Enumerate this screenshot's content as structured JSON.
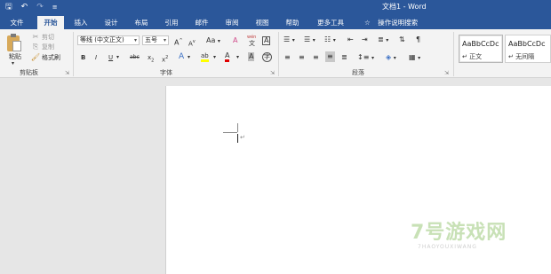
{
  "title_bar": {
    "document_title": "文档1 - Word",
    "save_icon": "save-icon",
    "undo_icon": "undo-icon",
    "redo_icon": "redo-icon",
    "customize_icon": "customize-qat-icon"
  },
  "tabs": [
    {
      "label": "文件",
      "active": false
    },
    {
      "label": "开始",
      "active": true
    },
    {
      "label": "插入",
      "active": false
    },
    {
      "label": "设计",
      "active": false
    },
    {
      "label": "布局",
      "active": false
    },
    {
      "label": "引用",
      "active": false
    },
    {
      "label": "邮件",
      "active": false
    },
    {
      "label": "审阅",
      "active": false
    },
    {
      "label": "视图",
      "active": false
    },
    {
      "label": "帮助",
      "active": false
    },
    {
      "label": "更多工具",
      "active": false
    }
  ],
  "tell_me": {
    "label": "操作说明搜索",
    "icon": "lightbulb-icon"
  },
  "clipboard": {
    "group_label": "剪贴板",
    "paste": "粘贴",
    "cut": "剪切",
    "copy": "复制",
    "format_painter": "格式刷"
  },
  "font": {
    "group_label": "字体",
    "font_name": "等线 (中文正文)",
    "font_size": "五号",
    "grow": "A",
    "shrink": "A",
    "change_case": "Aa",
    "clear": "A",
    "phonetic": "wén",
    "border_char": "A",
    "bold": "B",
    "italic": "I",
    "underline": "U",
    "strike": "abc",
    "subscript": "x",
    "superscript": "x",
    "text_effects": "A",
    "highlight": "ab",
    "font_color": "A",
    "char_shading": "A",
    "enclose": "字"
  },
  "paragraph": {
    "group_label": "段落"
  },
  "styles": [
    {
      "sample": "AaBbCcDc",
      "name": "↵ 正文"
    },
    {
      "sample": "AaBbCcDc",
      "name": "↵ 无间隔"
    }
  ],
  "colors": {
    "brand": "#2b579a",
    "ribbon_bg": "#f3f3f3",
    "highlight": "#ffff00",
    "font_color": "#e00000"
  },
  "watermark": {
    "logo": "7号游戏网",
    "url": "7HAOYOUXIWANG"
  }
}
